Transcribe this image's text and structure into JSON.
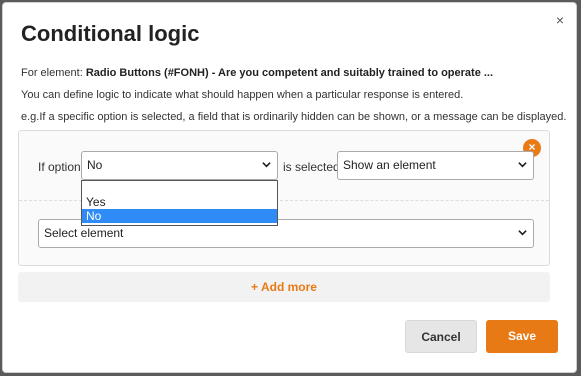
{
  "dialog": {
    "title": "Conditional logic",
    "close_glyph": "×",
    "element_prefix": "For element: ",
    "element_name": "Radio Buttons (#FONH) - Are you competent and suitably trained to operate ...",
    "description": "You can define logic to indicate what should happen when a particular response is entered.",
    "example": "e.g.If a specific option is selected, a field that is ordinarily hidden can be shown, or a message can be displayed."
  },
  "rule": {
    "if_option_label": "If option",
    "option_value": "No",
    "is_selected_label": "is selected,",
    "action_value": "Show an element",
    "element_select": "Select element",
    "remove_glyph": "×",
    "dropdown_options": [
      "",
      "Yes",
      "No"
    ],
    "dropdown_selected": "No"
  },
  "actions": {
    "add_more": "+ Add more",
    "cancel": "Cancel",
    "save": "Save"
  },
  "colors": {
    "accent": "#e87a16",
    "selected": "#2f8bf5"
  },
  "icons": {
    "close": "close-icon",
    "remove": "remove-icon",
    "chevron": "chevron-down-icon"
  }
}
